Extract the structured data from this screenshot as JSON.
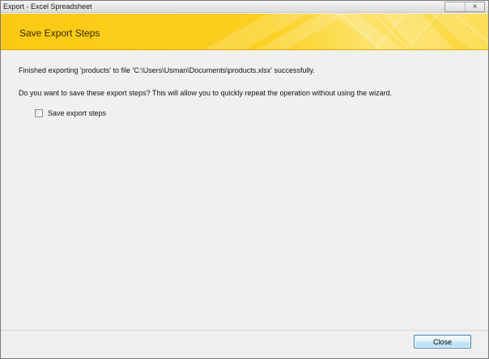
{
  "window": {
    "title": "Export - Excel Spreadsheet",
    "close_glyph": "×"
  },
  "banner": {
    "title": "Save Export Steps"
  },
  "content": {
    "status_message": "Finished exporting 'products' to file 'C:\\Users\\Usman\\Documents\\products.xlsx' successfully.",
    "question": "Do you want to save these export steps? This will allow you to quickly repeat the operation without using the wizard.",
    "checkbox_label": "Save export steps",
    "checkbox_checked": false
  },
  "footer": {
    "close_label": "Close"
  },
  "colors": {
    "banner_accent": "#fbc913",
    "banner_text": "#3a2c00",
    "button_border": "#3c7fb1"
  }
}
